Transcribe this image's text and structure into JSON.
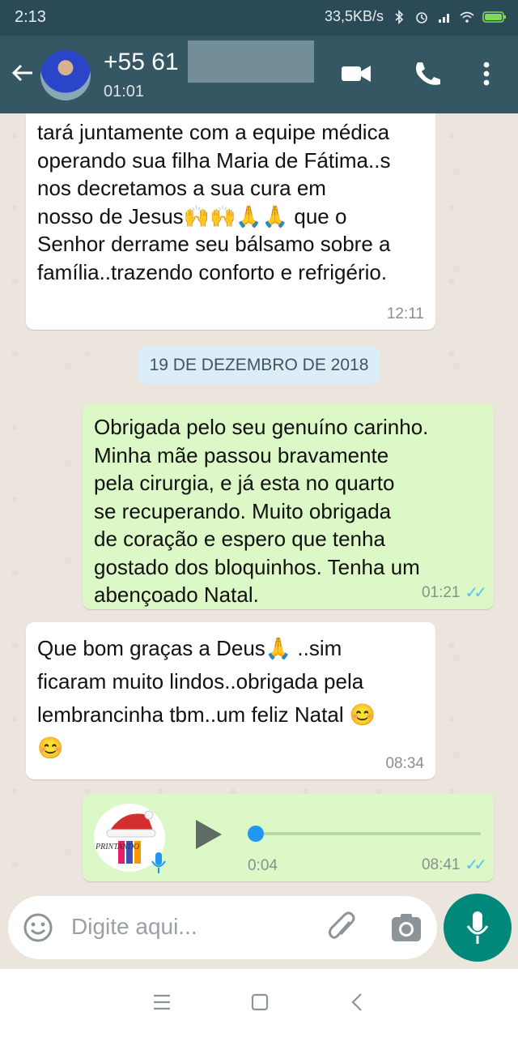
{
  "status_bar": {
    "time": "2:13",
    "network_speed": "33,5KB/s"
  },
  "header": {
    "title": "+55 61",
    "subtitle": "01:01"
  },
  "messages": [
    {
      "dir": "in",
      "text": "tará juntamente com a equipe médica\noperando sua filha Maria de Fátima..s\nnos decretamos a sua cura em\nnosso de Jesus🙌🙌🙏🙏 que o\nSenhor derrame seu bálsamo sobre a\nfamília..trazendo conforto e refrigério.",
      "time": "12:11"
    },
    {
      "type": "date",
      "text": "19 DE DEZEMBRO DE 2018"
    },
    {
      "dir": "out",
      "text": "Obrigada pelo seu genuíno carinho.\nMinha mãe passou bravamente\npela cirurgia, e já esta no quarto\nse recuperando. Muito obrigada\nde coração e espero que tenha\ngostado dos bloquinhos. Tenha um\nabençoado Natal.",
      "time": "01:21"
    },
    {
      "dir": "in",
      "text": "Que bom graças a Deus🙏 ..sim\nficaram muito lindos..obrigada pela\nlembrancinha tbm..um feliz Natal 😊\n😊",
      "time": "08:34"
    },
    {
      "dir": "out",
      "type": "audio",
      "avatar_text": "PRINTANDO",
      "duration": "0:04",
      "time": "08:41",
      "progress": 0
    }
  ],
  "input": {
    "placeholder": "Digite aqui..."
  },
  "colors": {
    "header": "#355663",
    "status_bar": "#2b4a57",
    "out_bubble": "#dcf8c6",
    "in_bubble": "#ffffff",
    "accent": "#00897b",
    "read_ticks": "#4fc3f7"
  },
  "icons": [
    "back-arrow-icon",
    "video-call-icon",
    "phone-icon",
    "more-vert-icon",
    "emoji-icon",
    "attach-icon",
    "camera-icon",
    "mic-icon",
    "play-icon",
    "double-check-icon",
    "menu-nav-icon",
    "home-nav-icon",
    "back-nav-icon"
  ]
}
